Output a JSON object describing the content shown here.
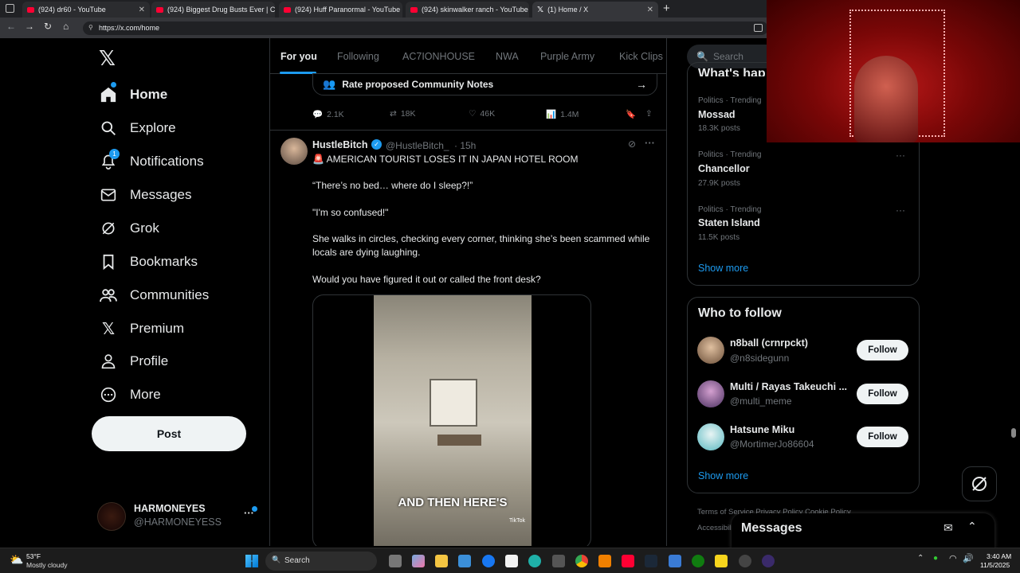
{
  "browser": {
    "tabs": [
      {
        "label": "(924) dr60 - YouTube",
        "type": "youtube"
      },
      {
        "label": "(924) Biggest Drug Busts Ever | C",
        "type": "youtube"
      },
      {
        "label": "(924) Huff Paranormal - YouTube",
        "type": "youtube"
      },
      {
        "label": "(924) skinwalker ranch - YouTube",
        "type": "youtube"
      },
      {
        "label": "(1) Home / X",
        "type": "x"
      }
    ],
    "url": "https://x.com/home"
  },
  "sidebar": {
    "items": [
      {
        "label": "Home",
        "icon": "home-icon"
      },
      {
        "label": "Explore",
        "icon": "search-icon"
      },
      {
        "label": "Notifications",
        "icon": "bell-icon",
        "badge": "1"
      },
      {
        "label": "Messages",
        "icon": "envelope-icon"
      },
      {
        "label": "Grok",
        "icon": "grok-icon"
      },
      {
        "label": "Bookmarks",
        "icon": "bookmark-icon"
      },
      {
        "label": "Communities",
        "icon": "people-icon"
      },
      {
        "label": "Premium",
        "icon": "x-logo-icon"
      },
      {
        "label": "Profile",
        "icon": "person-icon"
      },
      {
        "label": "More",
        "icon": "more-circle-icon"
      }
    ],
    "post_label": "Post",
    "account": {
      "name": "HARMONEYES",
      "handle": "@HARMONEYESS"
    }
  },
  "feed": {
    "tabs": [
      "For you",
      "Following",
      "AC7IONHOUSE",
      "NWA",
      "Purple Army",
      "Kick Clips"
    ],
    "rate_notes": "Rate proposed Community Notes",
    "prev_stats": {
      "replies": "2.1K",
      "reposts": "18K",
      "likes": "46K",
      "views": "1.4M"
    },
    "tweet": {
      "name": "HustleBitch",
      "handle": "@HustleBitch_",
      "time": "· 15h",
      "line1": "🚨 AMERICAN TOURIST LOSES IT IN JAPAN HOTEL ROOM",
      "line2": "“There’s no bed… where do I sleep?!”",
      "line3": "\"I'm so confused!\"",
      "line4": "She walks in circles, checking every corner, thinking she’s been scammed while locals are dying laughing.",
      "line5": "Would you have figured it out or called the front desk?",
      "video_caption": "AND THEN HERE'S",
      "tiktok_label": "TikTok"
    }
  },
  "right": {
    "search_placeholder": "Search",
    "trends": [
      {
        "meta": "Politics · Trending",
        "name": "Mossad",
        "count": "18.3K posts"
      },
      {
        "meta": "Politics · Trending",
        "name": "Chancellor",
        "count": "27.9K posts"
      },
      {
        "meta": "Politics · Trending",
        "name": "Staten Island",
        "count": "11.5K posts"
      }
    ],
    "show_more": "Show more",
    "who_title": "Who to follow",
    "follow": [
      {
        "name": "n8ball (crnrpckt)",
        "handle": "@n8sidegunn",
        "color": "#c9a27a"
      },
      {
        "name": "Multi / Rayas Takeuchi ...",
        "handle": "@multi_meme",
        "color": "#7a5c8a"
      },
      {
        "name": "Hatsune Miku",
        "handle": "@MortimerJo86604",
        "color": "#7fd0d6"
      }
    ],
    "follow_label": "Follow",
    "terms": "Terms of Service  Privacy Policy  Cookie Policy",
    "accessibility": "Accessibility",
    "messages_label": "Messages"
  },
  "taskbar": {
    "weather_temp": "53°F",
    "weather_desc": "Mostly cloudy",
    "search": "Search",
    "time": "3:40 AM",
    "date": "11/5/2025"
  }
}
